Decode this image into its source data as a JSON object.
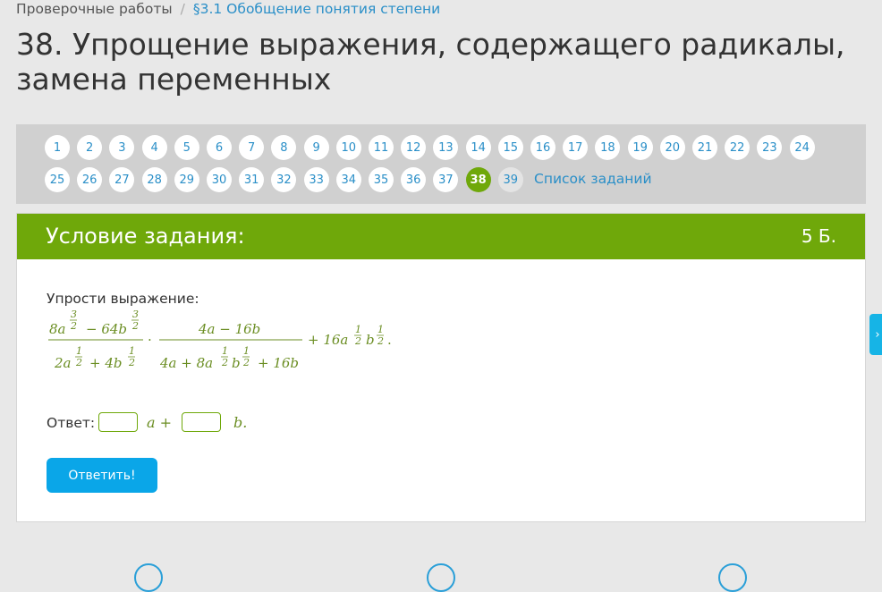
{
  "breadcrumb": {
    "items": [
      "Проверочные работы",
      "§3.1 Обобщение понятия степени"
    ],
    "separator": "/"
  },
  "page_title": "38. Упрощение выражения, содержащего радикалы, замена переменных",
  "task_nav": {
    "numbers": [
      "1",
      "2",
      "3",
      "4",
      "5",
      "6",
      "7",
      "8",
      "9",
      "10",
      "11",
      "12",
      "13",
      "14",
      "15",
      "16",
      "17",
      "18",
      "19",
      "20",
      "21",
      "22",
      "23",
      "24",
      "25",
      "26",
      "27",
      "28",
      "29",
      "30",
      "31",
      "32",
      "33",
      "34",
      "35",
      "36",
      "37",
      "38",
      "39"
    ],
    "current": "38",
    "list_link": "Список заданий"
  },
  "task": {
    "header_title": "Условие задания:",
    "points": "5 Б.",
    "prompt": "Упрости выражение:",
    "formula": {
      "num1": "8a",
      "num1_exp_n": "3",
      "num1_exp_d": "2",
      "num1_minus": "− 64b",
      "num1b_exp_n": "3",
      "num1b_exp_d": "2",
      "den1_a": "2a",
      "den1_a_exp_n": "1",
      "den1_a_exp_d": "2",
      "den1_plus": "+ 4b",
      "den1_b_exp_n": "1",
      "den1_b_exp_d": "2",
      "dot": "·",
      "num2": "4a − 16b",
      "den2_a": "4a + 8a",
      "den2_a_exp_n": "1",
      "den2_a_exp_d": "2",
      "den2_b": "b",
      "den2_b_exp_n": "1",
      "den2_b_exp_d": "2",
      "den2_tail": "+ 16b",
      "tail": "+ 16a",
      "tail_a_exp_n": "1",
      "tail_a_exp_d": "2",
      "tail_b": "b",
      "tail_b_exp_n": "1",
      "tail_b_exp_d": "2",
      "end": "."
    },
    "answer_label": "Ответ:",
    "answer_input1_value": "",
    "answer_var1": "a +",
    "answer_input2_value": "",
    "answer_var2": "b.",
    "submit_label": "Ответить!"
  },
  "colors": {
    "accent_green": "#6fa80a",
    "formula_green": "#6b8e23",
    "link_blue": "#2a8fc8",
    "button_blue": "#0aa6e8"
  },
  "side_tab_icon": "chevron-icon"
}
